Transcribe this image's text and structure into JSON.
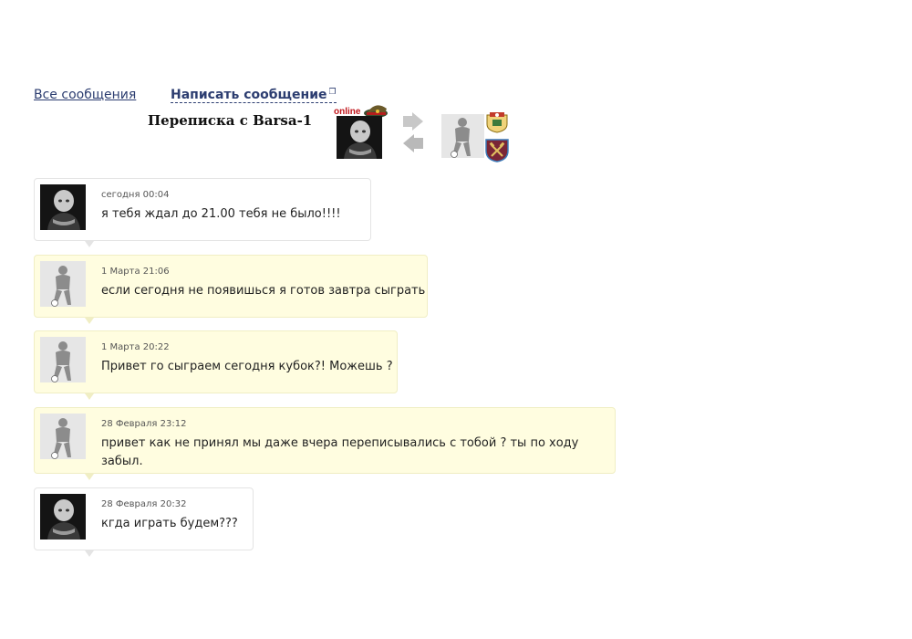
{
  "nav": {
    "all_messages": "Все сообщения",
    "write_message": "Написать сообщение"
  },
  "conversation": {
    "title": "Переписка с Barsa-1",
    "status": "online"
  },
  "messages": [
    {
      "author": "me",
      "time": "сегодня 00:04",
      "text": "я тебя ждал до 21.00 тебя не было!!!!"
    },
    {
      "author": "opponent",
      "time": "1 Марта 21:06",
      "text": "если сегодня не появишься я готов завтра сыграть"
    },
    {
      "author": "opponent",
      "time": "1 Марта 20:22",
      "text": "Привет го сыграем сегодня кубок?! Можешь ?"
    },
    {
      "author": "opponent",
      "time": "28 Февраля 23:12",
      "text": "привет как не принял мы даже вчера переписывались с тобой ? ты по ходу забыл."
    },
    {
      "author": "me",
      "time": "28 Февраля 20:32",
      "text": "кгда играть будем???"
    }
  ],
  "colors": {
    "link": "#2c3d70",
    "online": "#c0141a",
    "opponent_bubble": "#fffde0",
    "my_bubble": "#ffffff"
  }
}
